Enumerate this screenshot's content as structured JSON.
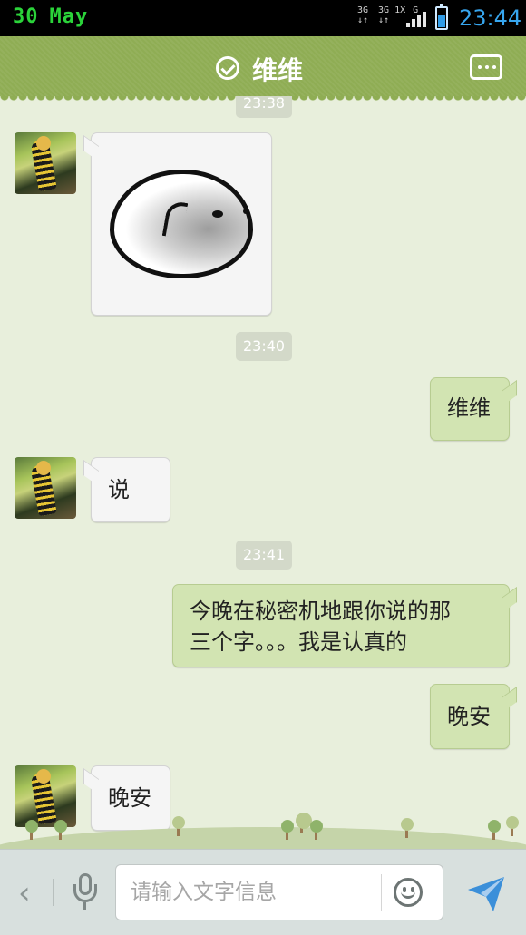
{
  "status_bar": {
    "date_day": "30",
    "date_month": "May",
    "network_left": "3G\n↓↑",
    "network_mid": "3G 1X\n↓↑",
    "network_right": "G",
    "time": "23:44",
    "battery_icon": "battery-icon",
    "signal_icon": "signal-bars-icon"
  },
  "header": {
    "contact_name": "维维",
    "verified_icon": "check-circle-icon",
    "menu_icon": "more-options-icon"
  },
  "messages": [
    {
      "type": "timestamp",
      "text": "23:38"
    },
    {
      "type": "sticker",
      "direction": "incoming",
      "description": "round-face-sticker"
    },
    {
      "type": "timestamp",
      "text": "23:40"
    },
    {
      "type": "text",
      "direction": "outgoing",
      "text": "维维"
    },
    {
      "type": "text",
      "direction": "incoming",
      "text": "说"
    },
    {
      "type": "timestamp",
      "text": "23:41"
    },
    {
      "type": "text",
      "direction": "outgoing",
      "text_line1": "今晚在秘密机地跟你说的那",
      "text_line2": "三个字。。。我是认真的"
    },
    {
      "type": "text",
      "direction": "outgoing",
      "text": "晚安"
    },
    {
      "type": "text",
      "direction": "incoming",
      "text": "晚安"
    }
  ],
  "input_bar": {
    "back_icon": "chevron-left-icon",
    "back_glyph": "‹",
    "voice_icon": "microphone-icon",
    "placeholder": "请输入文字信息",
    "value": "",
    "emoji_icon": "smiley-icon",
    "send_icon": "send-icon"
  },
  "colors": {
    "header_bg": "#8fad54",
    "chat_bg": "#e8efdc",
    "incoming_bubble": "#f5f5f5",
    "outgoing_bubble": "#d2e4b2",
    "clock": "#37a6ef",
    "date": "#2bd33a"
  }
}
